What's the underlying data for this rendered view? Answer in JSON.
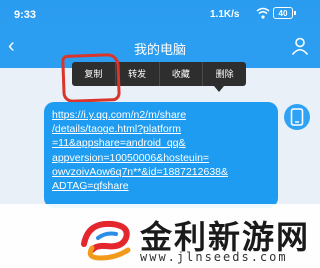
{
  "status_bar": {
    "time": "9:33",
    "network_speed": "1.1K/s",
    "battery": "40"
  },
  "header": {
    "title": "我的电脑"
  },
  "context_menu": {
    "items": [
      "复制",
      "转发",
      "收藏",
      "删除"
    ]
  },
  "message": {
    "text": "https://i.y.qq.com/n2/m/share\n/details/taoge.html?platform\n=11&appshare=android_qq&\nappversion=10050006&hosteuin=\nowvzoivAow6q7n**&id=1887212638&\nADTAG=qfshare"
  },
  "watermark": {
    "name": "金利新游网",
    "url": "www.jlnseeds.com"
  },
  "colors": {
    "header": "#2c9ef1",
    "bubble": "#1e9cf2",
    "highlight": "#d9352b"
  }
}
